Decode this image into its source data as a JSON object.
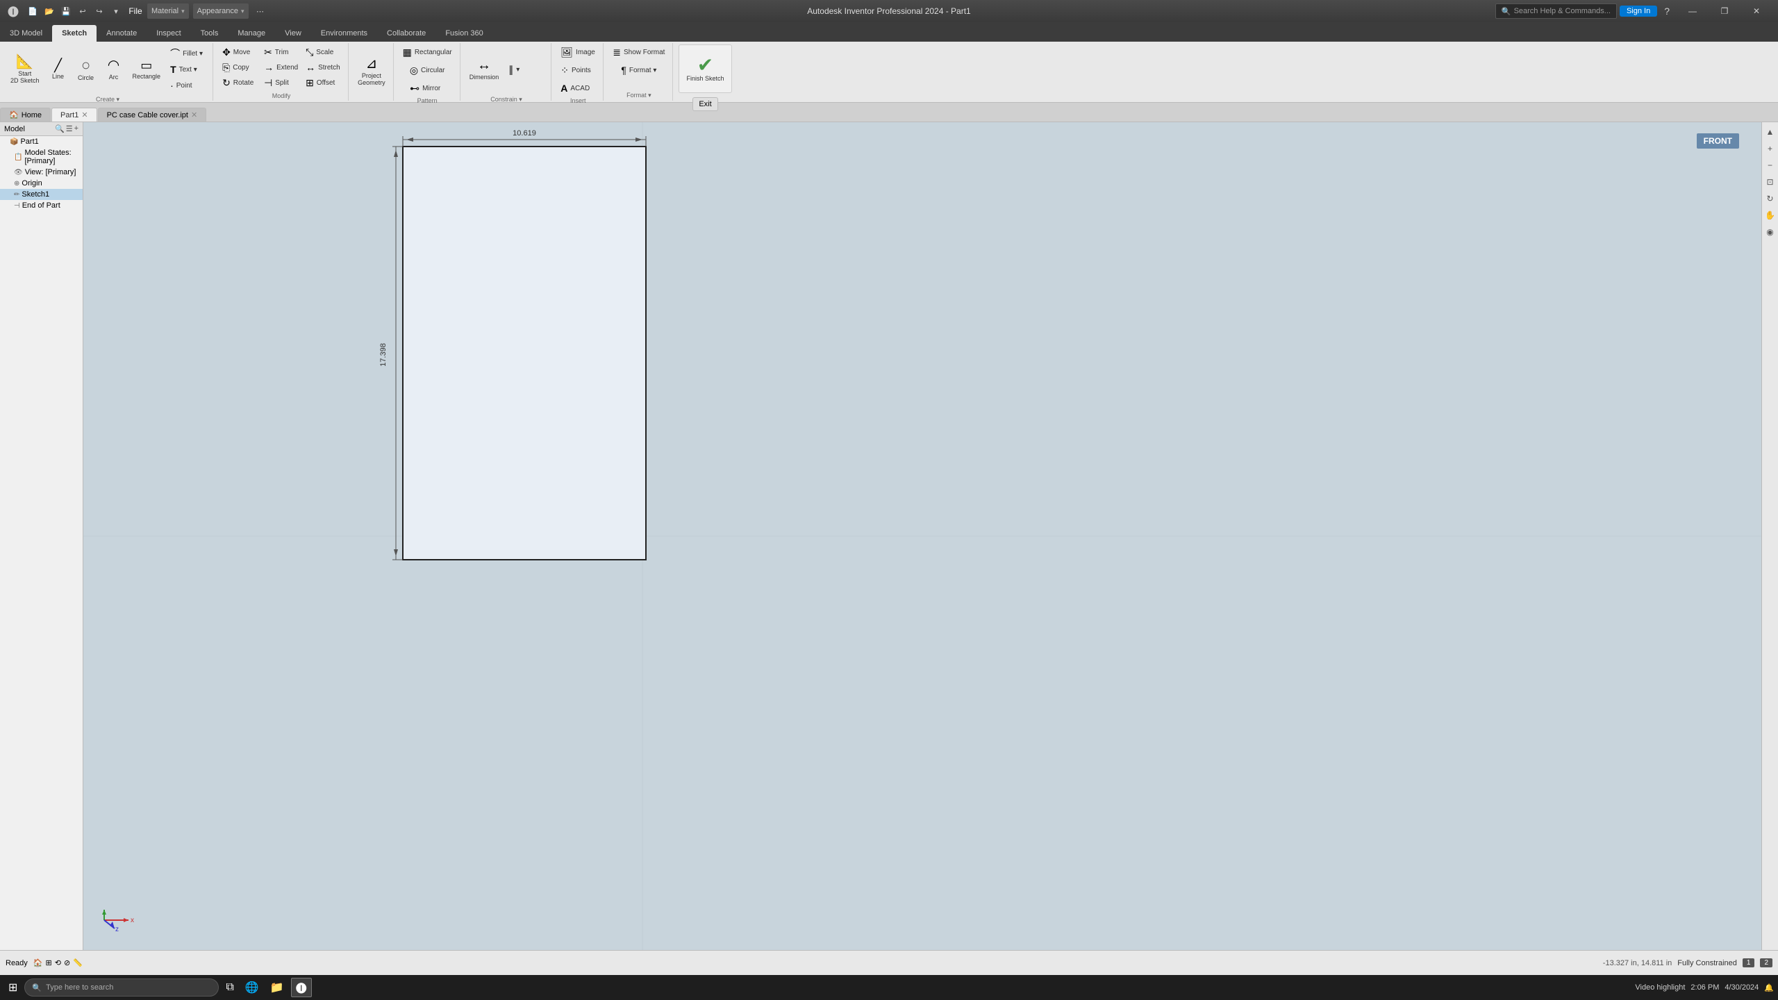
{
  "app": {
    "title": "Autodesk Inventor Professional 2024 - Part1",
    "search_help_placeholder": "Search Help & Commands...",
    "signin_label": "Sign In"
  },
  "title_bar": {
    "quick_access": [
      "new",
      "open",
      "save",
      "undo",
      "redo",
      "more"
    ],
    "file_label": "File",
    "material_label": "Material",
    "appearance_label": "Appearance"
  },
  "tabs": [
    {
      "id": "3dmodel",
      "label": "3D Model"
    },
    {
      "id": "sketch",
      "label": "Sketch",
      "active": true
    },
    {
      "id": "annotate",
      "label": "Annotate"
    },
    {
      "id": "inspect",
      "label": "Inspect"
    },
    {
      "id": "tools",
      "label": "Tools"
    },
    {
      "id": "manage",
      "label": "Manage"
    },
    {
      "id": "view",
      "label": "View"
    },
    {
      "id": "environments",
      "label": "Environments"
    },
    {
      "id": "collaborate",
      "label": "Collaborate"
    },
    {
      "id": "fusion360",
      "label": "Fusion 360"
    }
  ],
  "ribbon": {
    "create_group": {
      "label": "Create",
      "items": [
        {
          "id": "start2dsketch",
          "label": "Start\n2D Sketch",
          "icon": "📐",
          "large": true
        },
        {
          "id": "line",
          "label": "Line",
          "icon": "╱",
          "large": true
        },
        {
          "id": "circle",
          "label": "Circle",
          "icon": "○",
          "large": true
        },
        {
          "id": "arc",
          "label": "Arc",
          "icon": "◠",
          "large": true
        },
        {
          "id": "rectangle",
          "label": "Rectangle",
          "icon": "▭",
          "large": true
        },
        {
          "id": "fillet",
          "label": "Fillet ▾",
          "icon": "⌒",
          "small": true
        },
        {
          "id": "text",
          "label": "Text ▾",
          "icon": "T",
          "small": true
        },
        {
          "id": "point",
          "label": "Point",
          "icon": "·",
          "small": true
        }
      ]
    },
    "modify_group": {
      "label": "Modify",
      "items": [
        {
          "id": "move",
          "label": "Move",
          "icon": "✥",
          "small": true
        },
        {
          "id": "trim",
          "label": "Trim",
          "icon": "✂",
          "small": true
        },
        {
          "id": "scale",
          "label": "Scale",
          "icon": "⤡",
          "small": true
        },
        {
          "id": "copy",
          "label": "Copy",
          "icon": "⎘",
          "small": true
        },
        {
          "id": "extend",
          "label": "Extend",
          "icon": "→|",
          "small": true
        },
        {
          "id": "stretch",
          "label": "Stretch",
          "icon": "↔",
          "small": true
        },
        {
          "id": "rotate",
          "label": "Rotate",
          "icon": "↻",
          "small": true
        },
        {
          "id": "split",
          "label": "Split",
          "icon": "⊣",
          "small": true
        },
        {
          "id": "offset",
          "label": "Offset",
          "icon": "⊞",
          "small": true
        }
      ]
    },
    "project_group": {
      "label": "Project Geometry",
      "items": [
        {
          "id": "project_geometry",
          "label": "Project\nGeometry",
          "icon": "⊿",
          "large": true
        }
      ]
    },
    "pattern_group": {
      "label": "Pattern",
      "items": [
        {
          "id": "rectangular",
          "label": "Rectangular",
          "icon": "▦",
          "small": true
        },
        {
          "id": "circular_pattern",
          "label": "Circular",
          "icon": "◎",
          "small": true
        }
      ]
    },
    "constrain_group": {
      "label": "Constrain",
      "items": [
        {
          "id": "dimension",
          "label": "Dimension",
          "icon": "↔",
          "large": true
        },
        {
          "id": "more_constraints",
          "label": "▾",
          "small": true
        }
      ]
    },
    "insert_group": {
      "label": "Insert",
      "items": [
        {
          "id": "image",
          "label": "Image",
          "icon": "🖼",
          "small": true
        },
        {
          "id": "points",
          "label": "Points",
          "icon": "⁘",
          "small": true
        },
        {
          "id": "acad",
          "label": "ACAD",
          "icon": "A",
          "small": true
        }
      ]
    },
    "format_group": {
      "label": "Format",
      "items": [
        {
          "id": "show_format",
          "label": "Show Format",
          "icon": "≣",
          "small": true
        },
        {
          "id": "format",
          "label": "Format ▾",
          "icon": "¶",
          "small": true
        }
      ]
    },
    "finish_group": {
      "finish_sketch_label": "Finish\nSketch",
      "exit_label": "Exit"
    }
  },
  "model_tree": {
    "header": "Model",
    "items": [
      {
        "id": "part1",
        "label": "Part1",
        "level": 0,
        "icon": "📦"
      },
      {
        "id": "model_states",
        "label": "Model States: [Primary]",
        "level": 1,
        "icon": "📋"
      },
      {
        "id": "view_primary",
        "label": "View: [Primary]",
        "level": 1,
        "icon": "👁"
      },
      {
        "id": "origin",
        "label": "Origin",
        "level": 1,
        "icon": "⊕"
      },
      {
        "id": "sketch1",
        "label": "Sketch1",
        "level": 1,
        "icon": "✏",
        "selected": true
      },
      {
        "id": "end_of_part",
        "label": "End of Part",
        "level": 1,
        "icon": "⊣"
      }
    ]
  },
  "canvas": {
    "front_label": "FRONT",
    "dimension_top": "10.619",
    "dimension_side": "17.398",
    "background_color": "#c8d4dc"
  },
  "doc_tabs": [
    {
      "id": "home",
      "label": "Home",
      "closeable": false
    },
    {
      "id": "part1",
      "label": "Part1",
      "closeable": true,
      "active": true
    },
    {
      "id": "pc_case",
      "label": "PC case Cable cover.ipt",
      "closeable": true
    }
  ],
  "status_bar": {
    "ready_label": "Ready",
    "coordinates": "-13.327 in, 14.811 in",
    "constraint_label": "Fully Constrained",
    "page_num": "1",
    "zoom_num": "2"
  },
  "taskbar": {
    "search_placeholder": "Type here to search",
    "time": "2:06 PM",
    "date": "4/30/2024"
  },
  "right_panel_tools": [
    "▲",
    "△",
    "△",
    "□",
    "⬡",
    "◈",
    "⊞"
  ]
}
